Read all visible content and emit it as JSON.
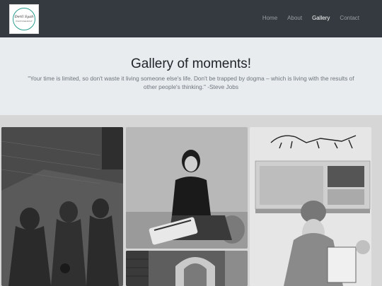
{
  "brand": {
    "logo_text": "Deril Syah",
    "logo_sub": "PHOTOGRAPHY"
  },
  "nav": {
    "items": [
      {
        "label": "Home",
        "active": false
      },
      {
        "label": "About",
        "active": false
      },
      {
        "label": "Gallery",
        "active": true
      },
      {
        "label": "Contact",
        "active": false
      }
    ]
  },
  "hero": {
    "title": "Gallery of moments!",
    "quote": "\"Your time is limited, so don't waste it living someone else's life. Don't be trapped by dogma – which is living with the results of other people's thinking.\" -Steve Jobs"
  },
  "gallery": {
    "photos": [
      {
        "name": "photo-shadows-on-wall",
        "description": "shadows"
      },
      {
        "name": "photo-woman-sitting",
        "description": "woman"
      },
      {
        "name": "photo-museum-dinosaur",
        "description": "museum"
      },
      {
        "name": "photo-architecture",
        "description": "arch"
      }
    ]
  },
  "colors": {
    "navbar": "#343a40",
    "hero_bg": "#e9ecef",
    "accent": "#2a9d8f"
  }
}
